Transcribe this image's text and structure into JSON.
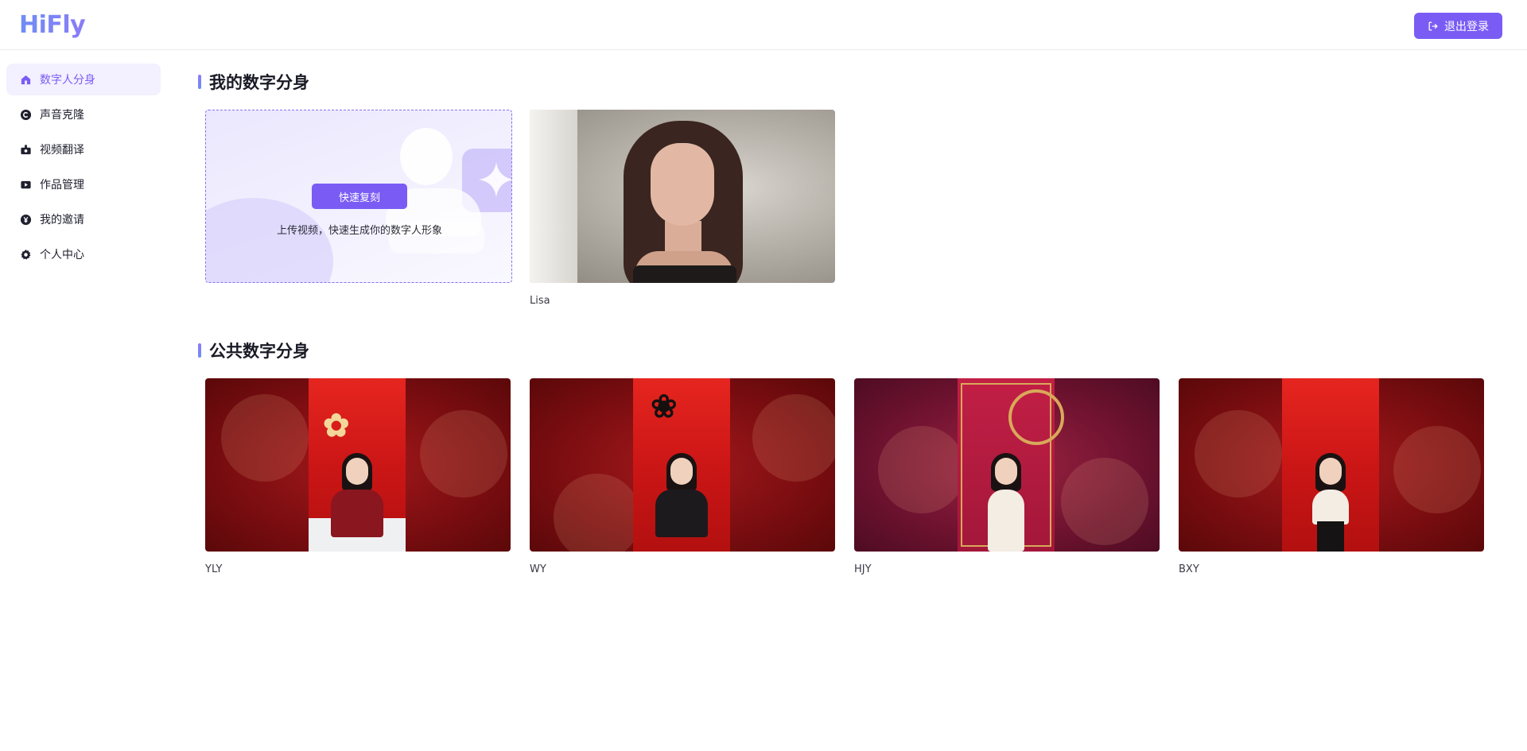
{
  "app": {
    "logo": "HiFly",
    "logout_label": "退出登录"
  },
  "sidebar": {
    "items": [
      {
        "label": "数字人分身",
        "icon": "home-icon",
        "active": true
      },
      {
        "label": "声音克隆",
        "icon": "voice-clone-icon",
        "active": false
      },
      {
        "label": "视频翻译",
        "icon": "video-translate-icon",
        "active": false
      },
      {
        "label": "作品管理",
        "icon": "play-icon",
        "active": false
      },
      {
        "label": "我的邀请",
        "icon": "yen-icon",
        "active": false
      },
      {
        "label": "个人中心",
        "icon": "gear-icon",
        "active": false
      }
    ]
  },
  "my_avatars": {
    "title": "我的数字分身",
    "upload": {
      "button_label": "快速复刻",
      "hint": "上传视频，快速生成你的数字人形象"
    },
    "items": [
      {
        "name": "Lisa"
      }
    ]
  },
  "public_avatars": {
    "title": "公共数字分身",
    "items": [
      {
        "name": "YLY"
      },
      {
        "name": "WY"
      },
      {
        "name": "HJY"
      },
      {
        "name": "BXY"
      }
    ]
  },
  "colors": {
    "accent": "#7a5cf5",
    "active_bg": "#f3f0ff"
  }
}
